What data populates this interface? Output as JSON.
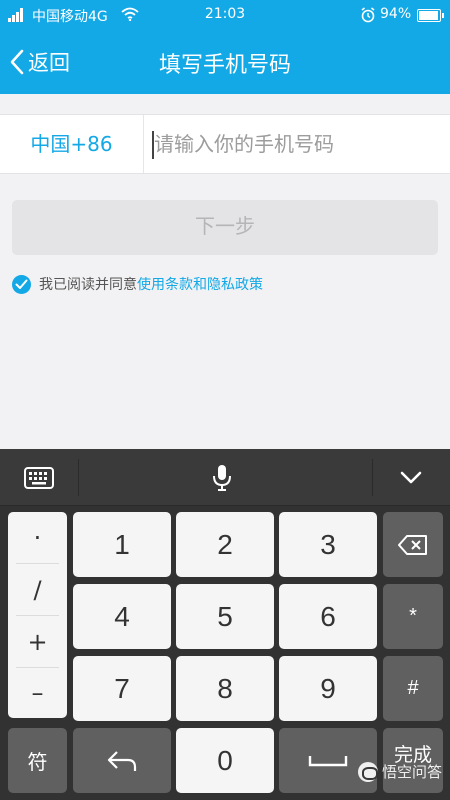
{
  "status_bar": {
    "carrier": "中国移动4G",
    "time": "21:03",
    "battery_percent_text": "94%",
    "battery_level": 0.94
  },
  "header": {
    "back_label": "返回",
    "title": "填写手机号码"
  },
  "phone": {
    "country_code": "中国+86",
    "placeholder": "请输入你的手机号码",
    "value": ""
  },
  "next_button_label": "下一步",
  "agreement": {
    "checked": true,
    "prefix": "我已阅读并同意",
    "link": "使用条款和隐私政策"
  },
  "keyboard": {
    "toolbar_icons": [
      "keyboard-icon",
      "microphone-icon",
      "chevron-down-icon"
    ],
    "symbols": [
      "·",
      "/",
      "+",
      "–"
    ],
    "digits": [
      "1",
      "2",
      "3",
      "4",
      "5",
      "6",
      "7",
      "8",
      "9",
      "0"
    ],
    "star": "*",
    "hash": "#",
    "symbol_key": "符",
    "done": "完成"
  },
  "watermark": "悟空问答",
  "colors": {
    "accent": "#13a8e6",
    "keyboard_bg": "#323232",
    "disabled_button": "#e4e4e6"
  }
}
